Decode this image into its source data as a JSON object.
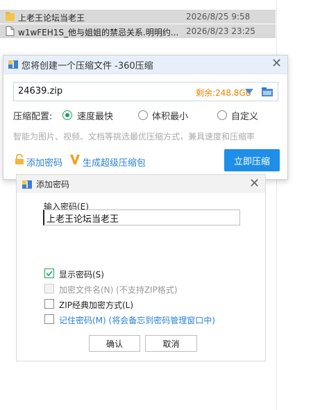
{
  "explorer": {
    "files": [
      {
        "icon": "folder-icon",
        "name": "上老王论坛当老王",
        "date": "2026/8/25 9:58"
      },
      {
        "icon": "file-icon",
        "name": "w1wFEH1S_他与姐姐的禁忌关系.明明约...",
        "date": "2026/8/23 23:25"
      }
    ]
  },
  "compress_dialog": {
    "title": "您将创建一个压缩文件 -360压缩",
    "path_value": "24639.zip",
    "remaining": "剩余:248.8GB",
    "config_label": "压缩配置:",
    "options": [
      {
        "label": "速度最快",
        "selected": true
      },
      {
        "label": "体积最小",
        "selected": false
      },
      {
        "label": "自定义",
        "selected": false
      }
    ],
    "hint": "智能为图片、视频、文档等挑选最优压缩方式，兼具速度和压缩率",
    "add_password": "添加密码",
    "super_pack": "生成超级压缩包",
    "compress_now": "立即压缩"
  },
  "password_dialog": {
    "title": "添加密码",
    "input_label": "输入密码(E)",
    "input_value": "上老王论坛当老王",
    "checkboxes": [
      {
        "label": "显示密码(S)",
        "checked": true,
        "disabled": false
      },
      {
        "label": "加密文件名(N) (不支持ZIP格式)",
        "checked": false,
        "disabled": true
      },
      {
        "label": "ZIP经典加密方式(L)",
        "checked": false,
        "disabled": false
      },
      {
        "label": "记住密码(M) (将会备忘到密码管理窗口中)",
        "checked": false,
        "disabled": false
      }
    ],
    "ok": "确认",
    "cancel": "取消"
  },
  "colors": {
    "accent_blue": "#1e8ee8",
    "check_green": "#1aa35a",
    "remain_orange": "#f08300"
  }
}
